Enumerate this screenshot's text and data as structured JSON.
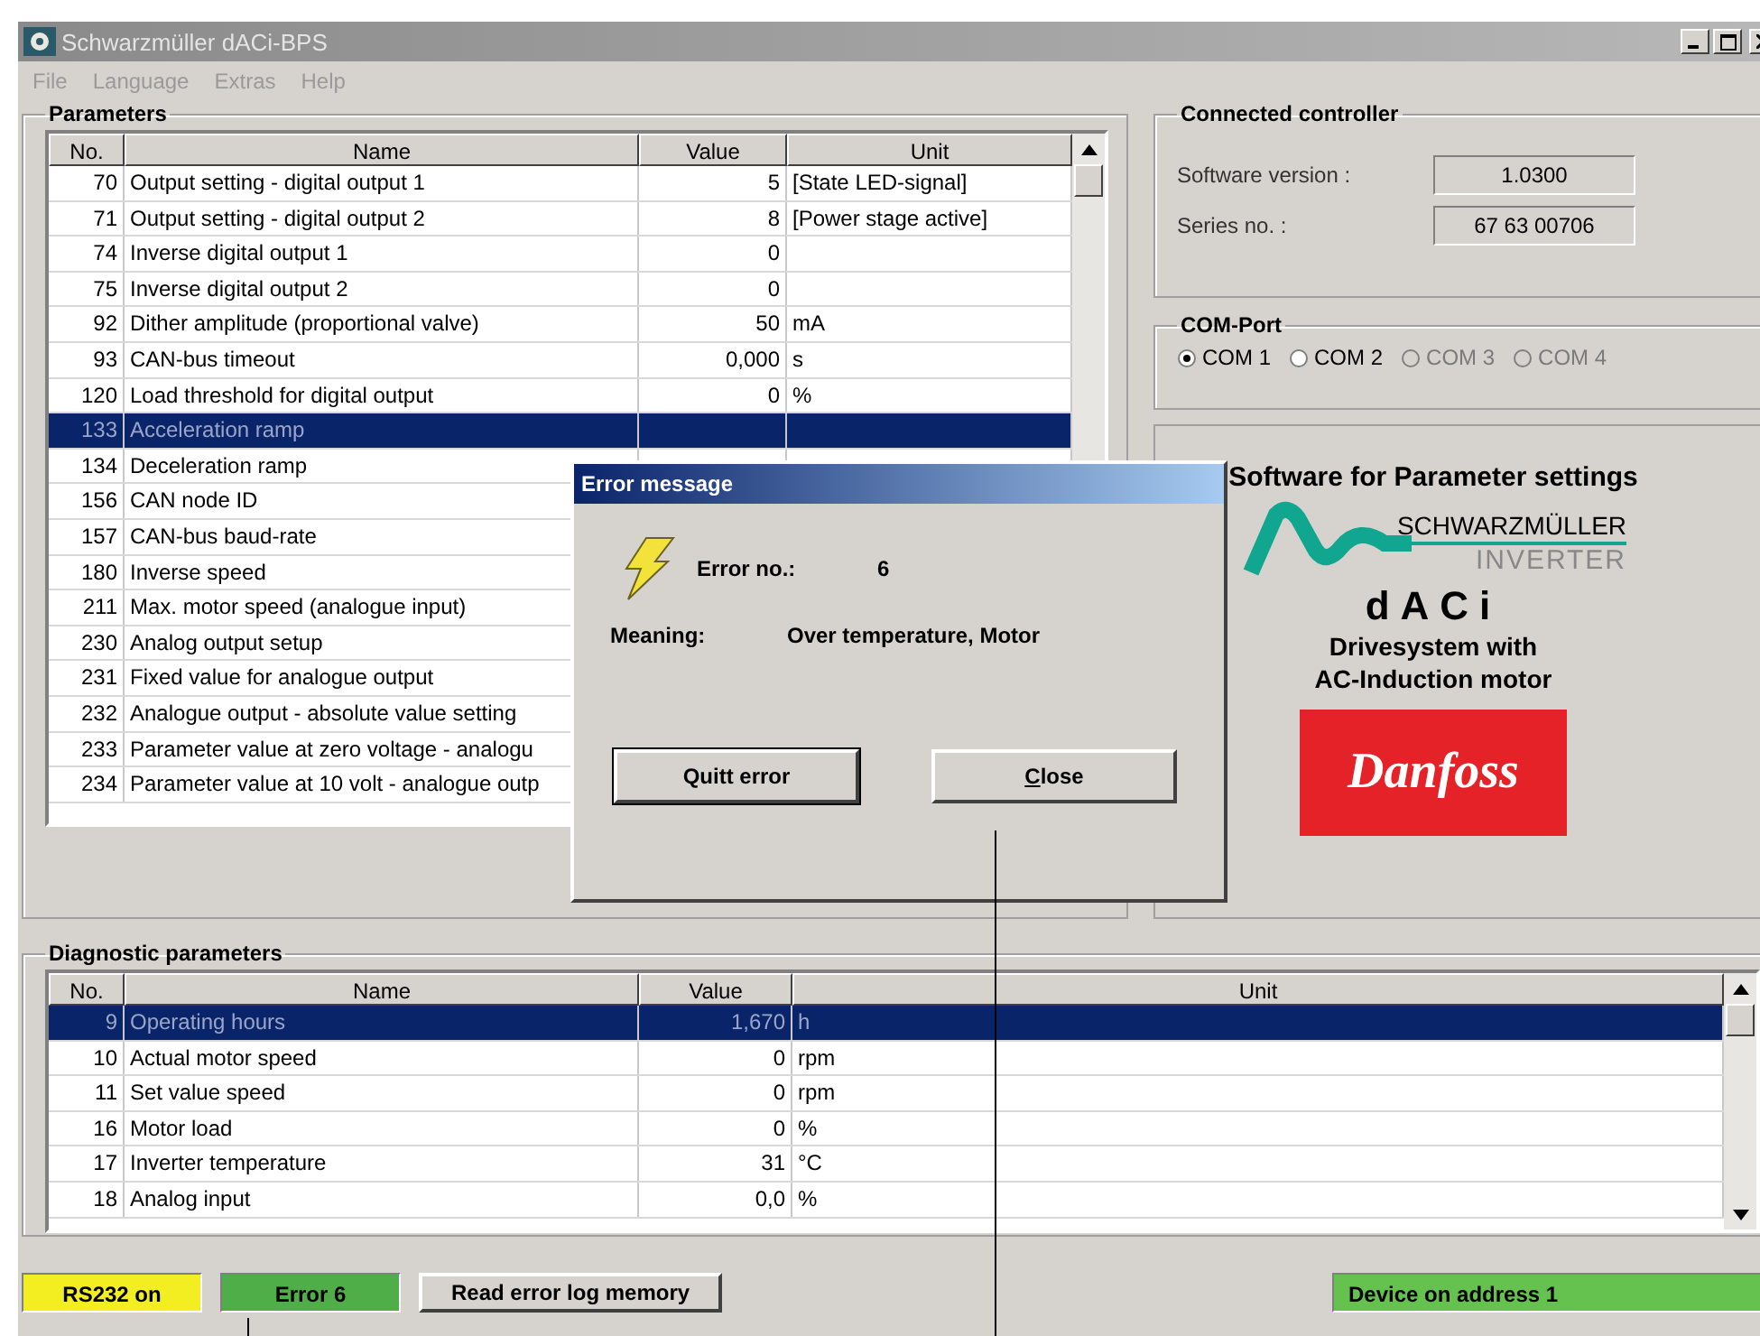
{
  "window": {
    "title": "Schwarzmüller dACi-BPS"
  },
  "menu": [
    "File",
    "Language",
    "Extras",
    "Help"
  ],
  "parameters": {
    "title": "Parameters",
    "columns": [
      "No.",
      "Name",
      "Value",
      "Unit"
    ],
    "rows": [
      {
        "no": "70",
        "name": "Output setting - digital output 1",
        "value": "5",
        "unit": "[State LED-signal]",
        "selected": false
      },
      {
        "no": "71",
        "name": "Output setting - digital output 2",
        "value": "8",
        "unit": "[Power stage active]",
        "selected": false
      },
      {
        "no": "74",
        "name": "Inverse digital output 1",
        "value": "0",
        "selected": false
      },
      {
        "no": "75",
        "name": "Inverse digital output 2",
        "value": "0",
        "selected": false
      },
      {
        "no": "92",
        "name": "Dither amplitude (proportional valve)",
        "value": "50",
        "unit": "mA",
        "selected": false
      },
      {
        "no": "93",
        "name": "CAN-bus timeout",
        "value": "0,000",
        "unit": "s",
        "selected": false
      },
      {
        "no": "120",
        "name": "Load threshold for digital output",
        "value": "0",
        "unit": "%",
        "selected": false
      },
      {
        "no": "133",
        "name": "Acceleration ramp",
        "selected": true
      },
      {
        "no": "134",
        "name": "Deceleration ramp",
        "selected": false
      },
      {
        "no": "156",
        "name": "CAN node ID",
        "selected": false
      },
      {
        "no": "157",
        "name": "CAN-bus baud-rate",
        "selected": false
      },
      {
        "no": "180",
        "name": "Inverse speed",
        "selected": false
      },
      {
        "no": "211",
        "name": "Max. motor speed (analogue input)",
        "selected": false
      },
      {
        "no": "230",
        "name": "Analog output setup",
        "selected": false
      },
      {
        "no": "231",
        "name": "Fixed value for analogue output",
        "selected": false
      },
      {
        "no": "232",
        "name": "Analogue output - absolute value setting",
        "selected": false
      },
      {
        "no": "233",
        "name": "Parameter value at zero voltage - analogu",
        "selected": false
      },
      {
        "no": "234",
        "name": "Parameter value at 10 volt - analogue outp",
        "selected": false
      }
    ]
  },
  "connected_controller": {
    "title": "Connected controller",
    "fields": [
      {
        "label": "Software version :",
        "value": "1.0300"
      },
      {
        "label": "Series no. :",
        "value": "67 63 00706"
      }
    ]
  },
  "com_port": {
    "title": "COM-Port",
    "options": [
      {
        "label": "COM 1",
        "selected": true,
        "disabled": false
      },
      {
        "label": "COM 2",
        "selected": false,
        "disabled": false
      },
      {
        "label": "COM 3",
        "selected": false,
        "disabled": true
      },
      {
        "label": "COM 4",
        "selected": false,
        "disabled": true
      }
    ]
  },
  "branding": {
    "heading": "Software for Parameter settings",
    "company": "SCHWARZMÜLLER",
    "company_sub": "INVERTER",
    "product": "dACi",
    "description": [
      "Drivesystem with",
      "AC-Induction motor"
    ],
    "partner": "Danfoss"
  },
  "diagnostics": {
    "title": "Diagnostic parameters",
    "columns": [
      "No.",
      "Name",
      "Value",
      "Unit"
    ],
    "rows": [
      {
        "no": "9",
        "name": "Operating hours",
        "value": "1,670",
        "unit": "h",
        "selected": true
      },
      {
        "no": "10",
        "name": "Actual motor speed",
        "value": "0",
        "unit": "rpm",
        "selected": false
      },
      {
        "no": "11",
        "name": "Set value speed",
        "value": "0",
        "unit": "rpm",
        "selected": false
      },
      {
        "no": "16",
        "name": "Motor load",
        "value": "0",
        "unit": "%",
        "selected": false
      },
      {
        "no": "17",
        "name": "Inverter temperature",
        "value": "31",
        "unit": "°C",
        "selected": false
      },
      {
        "no": "18",
        "name": "Analog input",
        "value": "0,0",
        "unit": "%",
        "selected": false
      }
    ]
  },
  "status_bar": [
    {
      "kind": "indicator",
      "text": "RS232 on",
      "color": "#f2ee22"
    },
    {
      "kind": "indicator",
      "text": "Error 6",
      "color": "#4fae48"
    },
    {
      "kind": "button",
      "text": "Read error log memory"
    },
    {
      "kind": "spacer"
    },
    {
      "kind": "indicator",
      "text": "Device on address 1",
      "color": "#66c24e"
    }
  ],
  "dialog": {
    "title": "Error message",
    "error_label": "Error no.:",
    "error_no": "6",
    "meaning_label": "Meaning:",
    "meaning": "Over temperature, Motor",
    "buttons": [
      {
        "label": "Quitt error",
        "default": true
      },
      {
        "label": "Close",
        "default": false
      }
    ]
  }
}
